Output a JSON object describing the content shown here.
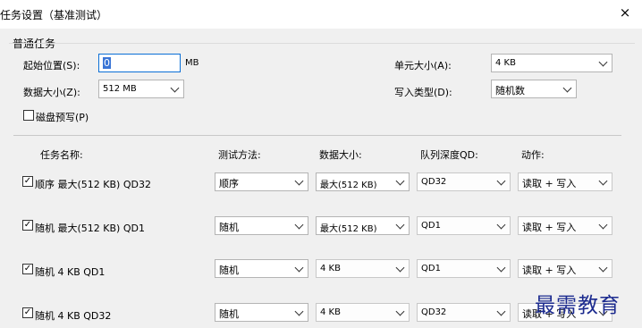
{
  "window": {
    "title": "任务设置（基准测试）",
    "close_icon": "×"
  },
  "general": {
    "group_label": "普通任务",
    "start_label": "起始位置(S):",
    "start_value": "0",
    "start_unit": "MB",
    "unit_size_label": "单元大小(A):",
    "unit_size_value": "4 KB",
    "data_size_label": "数据大小(Z):",
    "data_size_value": "512 MB",
    "write_type_label": "写入类型(D):",
    "write_type_value": "随机数",
    "prewrite_label": "磁盘预写(P)",
    "prewrite_checked": false
  },
  "columns": {
    "name": "任务名称:",
    "method": "测试方法:",
    "size": "数据大小:",
    "qd": "队列深度QD:",
    "action": "动作:"
  },
  "tasks": [
    {
      "checked": true,
      "name": "顺序 最大(512 KB) QD32",
      "method": "顺序",
      "size": "最大(512 KB)",
      "qd": "QD32",
      "action": "读取 + 写入"
    },
    {
      "checked": true,
      "name": "随机 最大(512 KB) QD1",
      "method": "随机",
      "size": "最大(512 KB)",
      "qd": "QD1",
      "action": "读取 + 写入"
    },
    {
      "checked": true,
      "name": "随机 4 KB QD1",
      "method": "随机",
      "size": "4 KB",
      "qd": "QD1",
      "action": "读取 + 写入"
    },
    {
      "checked": true,
      "name": "随机 4 KB QD32",
      "method": "随机",
      "size": "4 KB",
      "qd": "QD32",
      "action": "读取 + 写入"
    }
  ],
  "watermark": "最需教育"
}
